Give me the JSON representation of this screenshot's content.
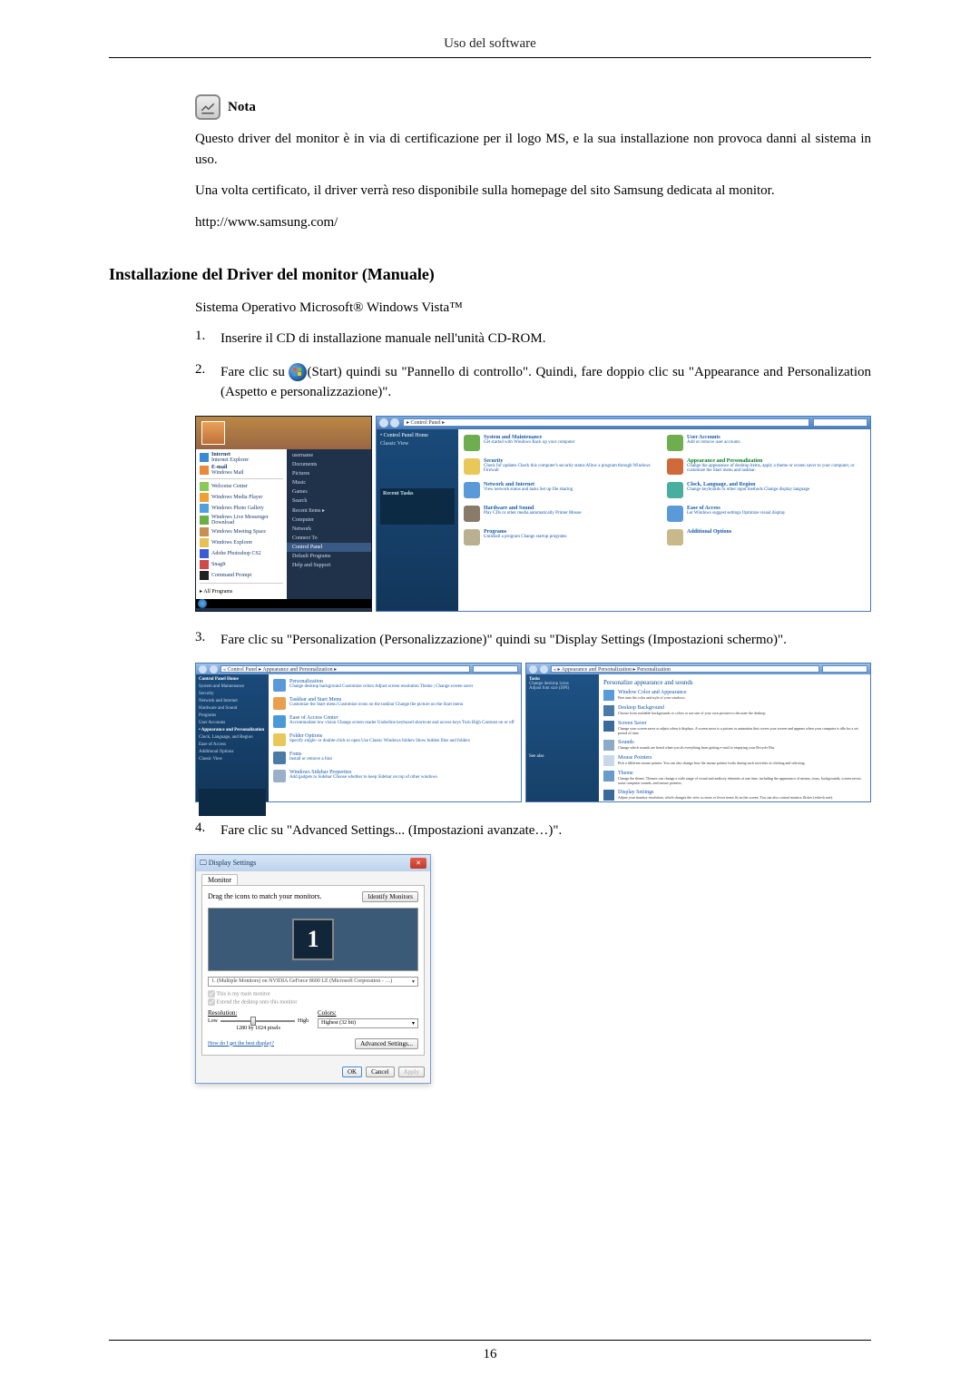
{
  "header": {
    "title": "Uso del software"
  },
  "note": {
    "label": "Nota",
    "p1": "Questo driver del monitor è in via di certificazione per il logo MS, e la sua installazione non provoca danni al sistema in uso.",
    "p2": "Una volta certificato, il driver verrà reso disponibile sulla homepage del sito Samsung dedicata al monitor.",
    "url": "http://www.samsung.com/"
  },
  "section": {
    "heading": "Installazione del Driver del monitor (Manuale)"
  },
  "intro": "Sistema Operativo Microsoft® Windows Vista™",
  "steps": {
    "s1": {
      "num": "1.",
      "text": "Inserire il CD di installazione manuale nell'unità CD-ROM."
    },
    "s2": {
      "num": "2.",
      "pre": "Fare clic su ",
      "post": "(Start) quindi su \"Pannello di controllo\". Quindi, fare doppio clic su \"Appearance and Personalization (Aspetto e personalizzazione)\"."
    },
    "s3": {
      "num": "3.",
      "text": "Fare clic su \"Personalization (Personalizzazione)\" quindi su \"Display Settings (Impostazioni schermo)\"."
    },
    "s4": {
      "num": "4.",
      "text": "Fare clic su \"Advanced Settings... (Impostazioni avanzate…)\"."
    }
  },
  "fig1": {
    "start_left": {
      "internet": "Internet",
      "internet_sub": "Internet Explorer",
      "email": "E-mail",
      "email_sub": "Windows Mail",
      "welcome": "Welcome Center",
      "wmp": "Windows Media Player",
      "gallery": "Windows Photo Gallery",
      "wlmd": "Windows Live Messenger Download",
      "meeting": "Windows Meeting Space",
      "explorer": "Windows Explorer",
      "ps": "Adobe Photoshop CS2",
      "snaglt": "SnagIt",
      "cmd": "Command Prompt",
      "all": "All Programs"
    },
    "start_right": {
      "username": "username",
      "documents": "Documents",
      "pictures": "Pictures",
      "music": "Music",
      "games": "Games",
      "search": "Search",
      "recent": "Recent Items",
      "computer": "Computer",
      "network": "Network",
      "connect": "Connect To",
      "cp": "Control Panel",
      "defaults": "Default Programs",
      "help": "Help and Support"
    },
    "cp": {
      "addr": "▸ Control Panel ▸",
      "side_h": "Control Panel Home",
      "side_classic": "Classic View",
      "task_h": "Recent Tasks",
      "cats": {
        "system": {
          "t": "System and Maintenance",
          "s": "Get started with Windows\nBack up your computer"
        },
        "security": {
          "t": "Security",
          "s": "Check for updates\nCheck this computer's security status\nAllow a program through Windows Firewall"
        },
        "network": {
          "t": "Network and Internet",
          "s": "View network status and tasks\nSet up file sharing"
        },
        "hardware": {
          "t": "Hardware and Sound",
          "s": "Play CDs or other media automatically\nPrinter\nMouse"
        },
        "programs": {
          "t": "Programs",
          "s": "Uninstall a program\nChange startup programs"
        },
        "user": {
          "t": "User Accounts",
          "s": "Add or remove user accounts"
        },
        "appearance": {
          "t": "Appearance and Personalization",
          "s": "Change the appearance of desktop items, apply a theme or screen saver to your computer, or customize the Start menu and taskbar."
        },
        "clock": {
          "t": "Clock, Language, and Region",
          "s": "Change keyboards or other input methods\nChange display language"
        },
        "ease": {
          "t": "Ease of Access",
          "s": "Let Windows suggest settings\nOptimize visual display"
        },
        "addl": {
          "t": "Additional Options"
        }
      }
    }
  },
  "fig2": {
    "left": {
      "addr": "« Control Panel ▸ Appearance and Personalization ▸",
      "side": {
        "cph": "Control Panel Home",
        "sm": "System and Maintenance",
        "sec": "Security",
        "ni": "Network and Internet",
        "hs": "Hardware and Sound",
        "pr": "Programs",
        "ua": "User Accounts",
        "ap": "Appearance and Personalization",
        "clr": "Clock, Language, and Region",
        "ea": "Ease of Access",
        "ao": "Additional Options",
        "cv": "Classic View"
      },
      "rows": {
        "pers": {
          "t": "Personalization",
          "s": "Change desktop background   Customize colors   Adjust screen resolution\nTheme | Change screen saver"
        },
        "tsm": {
          "t": "Taskbar and Start Menu",
          "s": "Customize the Start menu   Customize icons on the taskbar\nChange the picture on the Start menu"
        },
        "eac": {
          "t": "Ease of Access Center",
          "s": "Accommodate low vision   Change screen reader\nUnderline keyboard shortcuts and access keys   Turn High Contrast on or off"
        },
        "fo": {
          "t": "Folder Options",
          "s": "Specify single- or double-click to open   Use Classic Windows folders\nShow hidden files and folders"
        },
        "fonts": {
          "t": "Fonts",
          "s": "Install or remove a font"
        },
        "wsb": {
          "t": "Windows Sidebar Properties",
          "s": "Add gadgets to Sidebar   Choose whether to keep Sidebar on top of other windows"
        }
      }
    },
    "right": {
      "addr": "« ▸ Appearance and Personalization ▸ Personalization",
      "side": {
        "tasks": "Tasks",
        "cdi": "Change desktop icons",
        "afs": "Adjust font size (DPI)"
      },
      "hd": "Personalize appearance and sounds",
      "items": {
        "wca": {
          "t": "Window Color and Appearance",
          "s": "Fine tune the color and style of your windows."
        },
        "db": {
          "t": "Desktop Background",
          "s": "Choose from available backgrounds or colors or use one of your own pictures to decorate the desktop."
        },
        "ss": {
          "t": "Screen Saver",
          "s": "Change your screen saver or adjust when it displays. A screen saver is a picture or animation that covers your screen and appears when your computer is idle for a set period of time."
        },
        "snd": {
          "t": "Sounds",
          "s": "Change which sounds are heard when you do everything from getting e-mail to emptying your Recycle Bin."
        },
        "mp": {
          "t": "Mouse Pointers",
          "s": "Pick a different mouse pointer. You can also change how the mouse pointer looks during such activities as clicking and selecting."
        },
        "th": {
          "t": "Theme",
          "s": "Change the theme. Themes can change a wide range of visual and auditory elements at one time, including the appearance of menus, icons, backgrounds, screen savers, some computer sounds, and mouse pointers."
        },
        "ds": {
          "t": "Display Settings",
          "s": "Adjust your monitor resolution, which changes the view so more or fewer items fit on the screen. You can also control monitor flicker (refresh rate)."
        }
      },
      "see": "See also"
    }
  },
  "fig3": {
    "title": "Display Settings",
    "tab": "Monitor",
    "drag": "Drag the icons to match your monitors.",
    "identify": "Identify Monitors",
    "mon_num": "1",
    "select": "1. (Multiple Monitors) on NVIDIA GeForce 8600 LE (Microsoft Corporation - …)",
    "chk1": "This is my main monitor",
    "chk2": "Extend the desktop onto this monitor",
    "res_lbl": "Resolution:",
    "low": "Low",
    "high": "High",
    "res_val": "1280 by 1024 pixels",
    "col_lbl": "Colors:",
    "col_val": "Highest (32 bit)",
    "howlink": "How do I get the best display?",
    "adv": "Advanced Settings...",
    "ok": "OK",
    "cancel": "Cancel",
    "apply": "Apply"
  },
  "page_number": "16"
}
